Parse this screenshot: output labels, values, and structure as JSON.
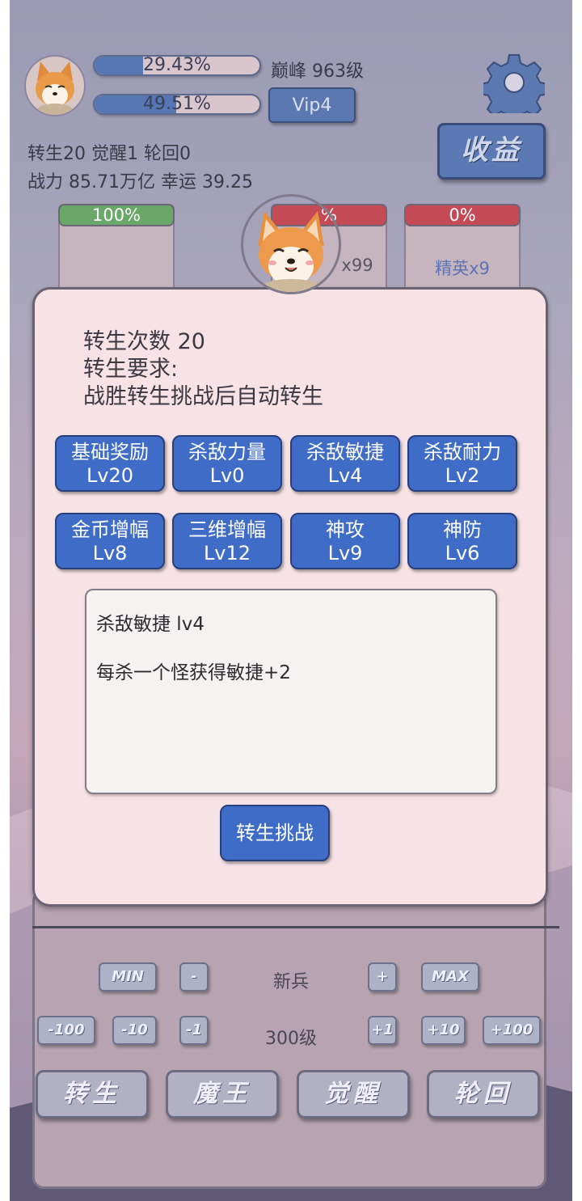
{
  "player": {
    "bar1_text": "29.43%",
    "bar1_fraction": 0.2943,
    "bar2_text": "49.51%",
    "bar2_fraction": 0.4951,
    "peak_level": "巅峰 963级",
    "vip": "Vip4",
    "earnings_button": "收益",
    "stats_line1": "转生20 觉醒1 轮回0",
    "stats_line2": "战力 85.71万亿  幸运 39.25"
  },
  "enemies": [
    {
      "hp": "100%",
      "name": "",
      "hp_color": "#6aa86a"
    },
    {
      "hp": "%",
      "name": "x99",
      "hp_color": "#c44b55"
    },
    {
      "hp": "0%",
      "name": "精英x9",
      "hp_color": "#c44b55"
    }
  ],
  "modal": {
    "line1": "转生次数 20",
    "line2": "转生要求:",
    "line3": "战胜转生挑战后自动转生",
    "skills": [
      {
        "name": "基础奖励",
        "level": "Lv20"
      },
      {
        "name": "杀敌力量",
        "level": "Lv0"
      },
      {
        "name": "杀敌敏捷",
        "level": "Lv4"
      },
      {
        "name": "杀敌耐力",
        "level": "Lv2"
      },
      {
        "name": "金币增幅",
        "level": "Lv8"
      },
      {
        "name": "三维增幅",
        "level": "Lv12"
      },
      {
        "name": "神攻",
        "level": "Lv9"
      },
      {
        "name": "神防",
        "level": "Lv6"
      }
    ],
    "desc_title": "杀敌敏捷 lv4",
    "desc_text": "每杀一个怪获得敏捷+2",
    "challenge_button": "转生挑战"
  },
  "controls": {
    "min": "MIN",
    "minus": "-",
    "unit_name": "新兵",
    "plus": "+",
    "max": "MAX",
    "m100": "-100",
    "m10": "-10",
    "m1": "-1",
    "level_value": "300级",
    "p1": "+1",
    "p10": "+10",
    "p100": "+100",
    "tab_rebirth": "转生",
    "tab_demon": "魔王",
    "tab_awaken": "觉醒",
    "tab_reincarnation": "轮回"
  },
  "colors": {
    "accent_blue": "#3f6cc7",
    "modal_bg": "#f7e2e6"
  }
}
